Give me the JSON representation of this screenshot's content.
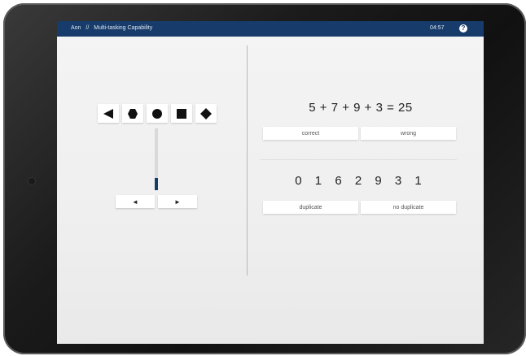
{
  "header": {
    "brand": "Aon",
    "separator": "//",
    "title": "Multi-tasking Capability",
    "timer": "04:57",
    "help_glyph": "?"
  },
  "colors": {
    "header_bg": "#173c6b",
    "accent": "#173c6b",
    "screen_bg": "#efefef"
  },
  "left_task": {
    "shapes": [
      {
        "icon": "triangle-left-icon"
      },
      {
        "icon": "hexagon-icon"
      },
      {
        "icon": "circle-icon"
      },
      {
        "icon": "square-icon"
      },
      {
        "icon": "diamond-icon"
      }
    ],
    "level_fraction": 0.2,
    "left_arrow": "◄",
    "right_arrow": "►"
  },
  "right_task": {
    "equation": "5 + 7 + 9 + 3 = 25",
    "correct_label": "correct",
    "wrong_label": "wrong",
    "sequence": "0 1 6 2 9 3 1",
    "duplicate_label": "duplicate",
    "no_duplicate_label": "no duplicate"
  }
}
